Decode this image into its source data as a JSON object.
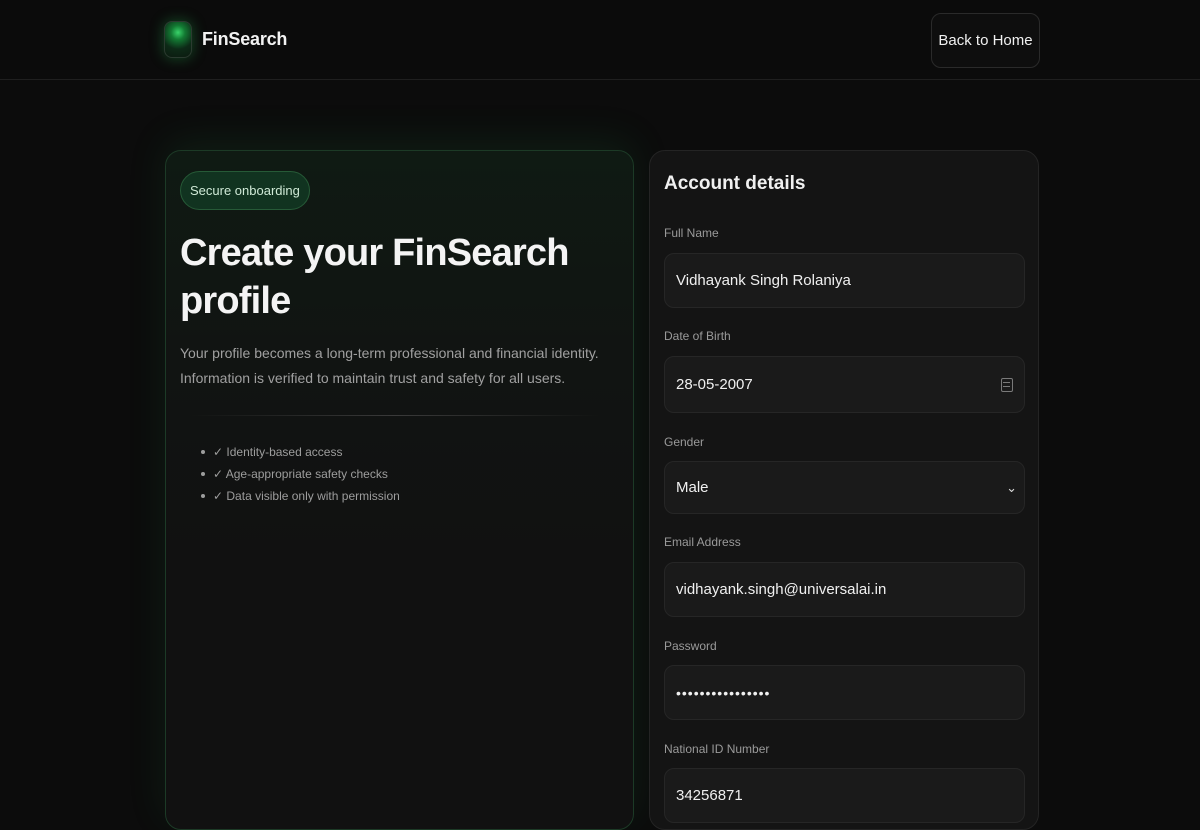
{
  "header": {
    "brand": "FinSearch",
    "back_button": "Back to Home"
  },
  "hero": {
    "badge": "Secure onboarding",
    "title": "Create your FinSearch profile",
    "description": "Your profile becomes a long-term professional and financial identity. Information is verified to maintain trust and safety for all users.",
    "features": [
      "✓ Identity-based access",
      "✓ Age-appropriate safety checks",
      "✓ Data visible only with permission"
    ]
  },
  "form": {
    "title": "Account details",
    "full_name": {
      "label": "Full Name",
      "value": "Vidhayank Singh Rolaniya"
    },
    "dob": {
      "label": "Date of Birth",
      "value": "28-05-2007"
    },
    "gender": {
      "label": "Gender",
      "value": "Male"
    },
    "email": {
      "label": "Email Address",
      "value": "vidhayank.singh@universalai.in"
    },
    "password": {
      "label": "Password",
      "value": "••••••••••••••••"
    },
    "national_id": {
      "label": "National ID Number",
      "value": "34256871"
    }
  },
  "colors": {
    "background": "#0c0c0c",
    "accent_green": "#39d46a",
    "card": "#141414"
  }
}
